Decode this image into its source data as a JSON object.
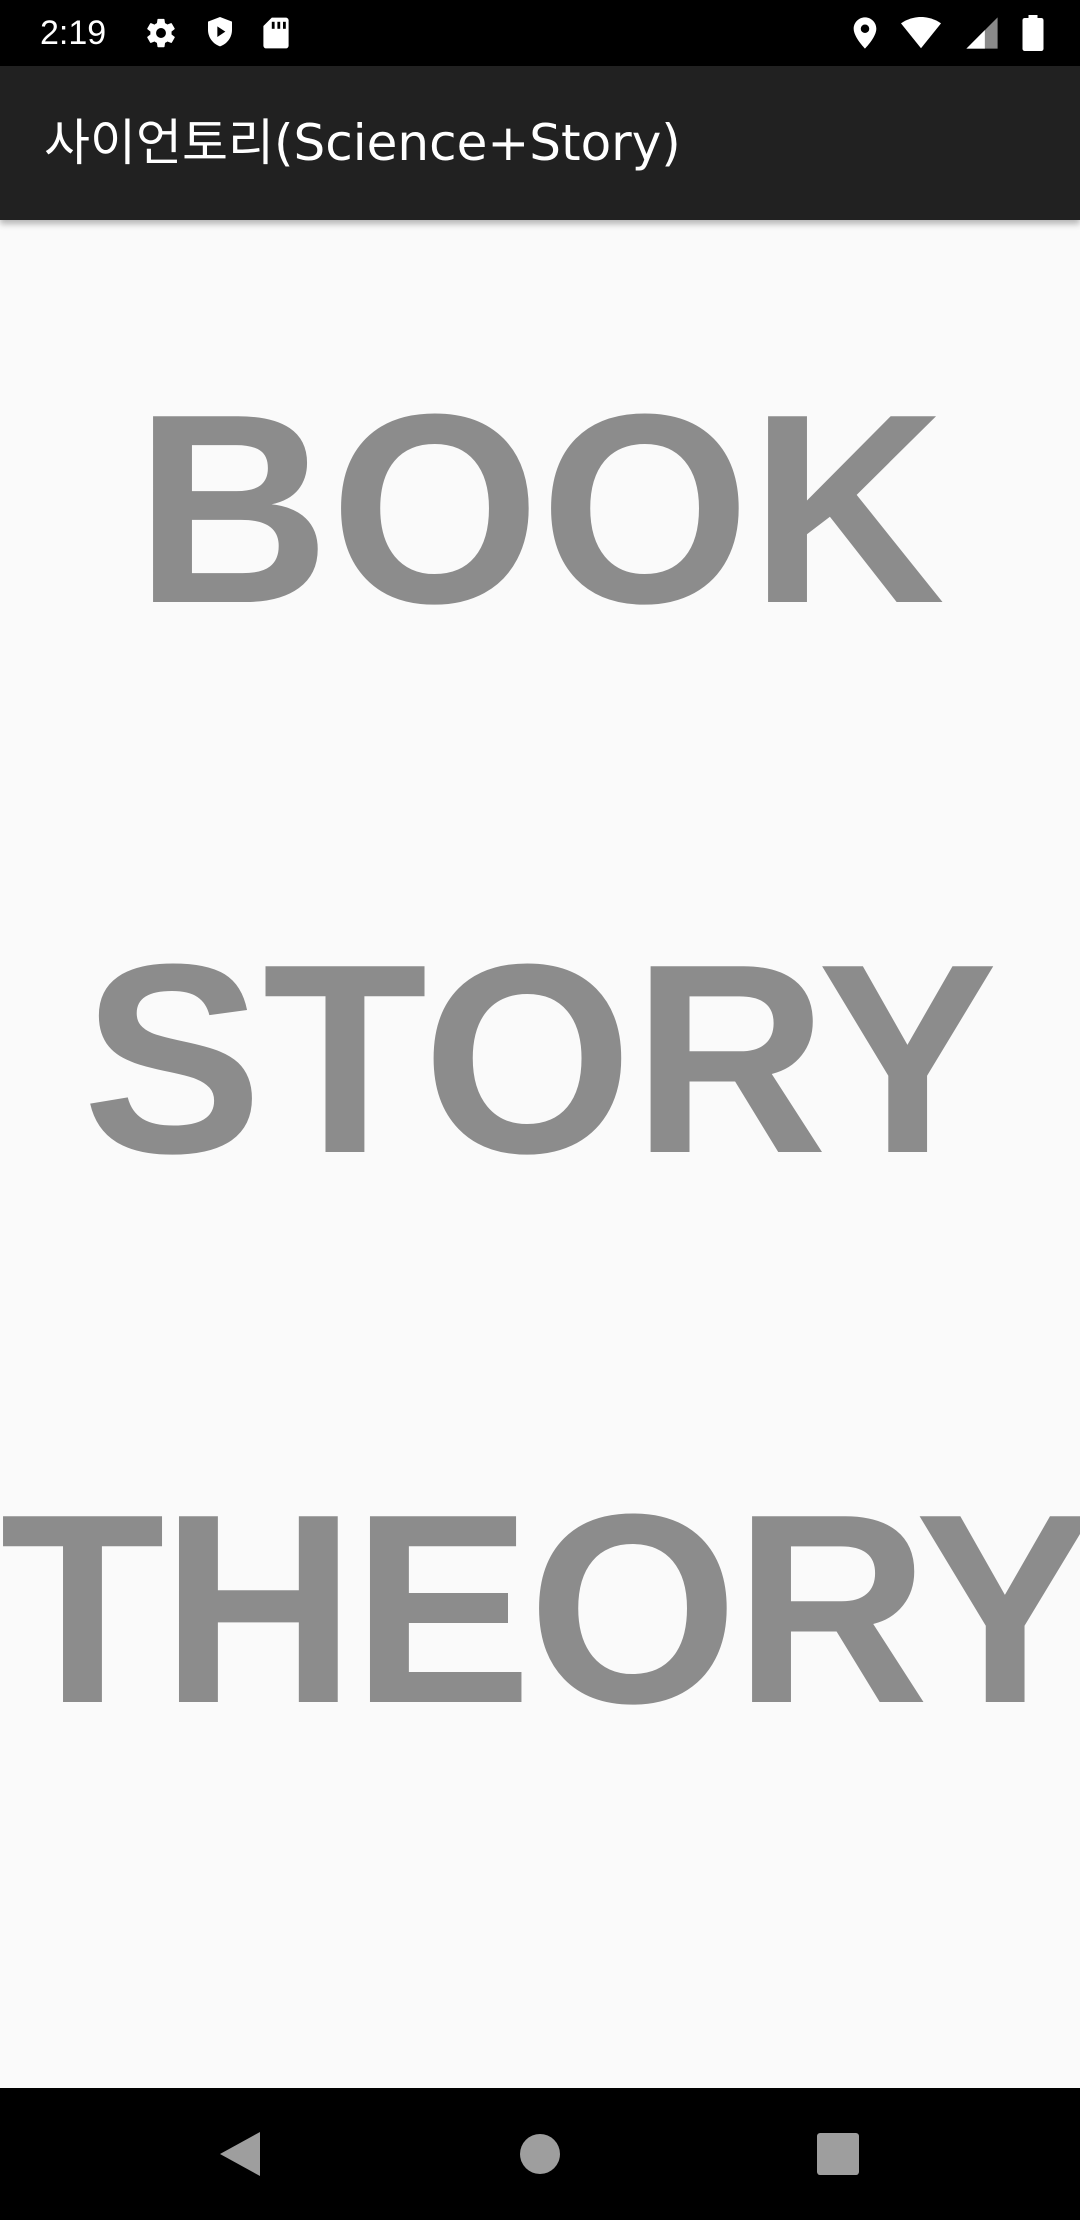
{
  "status_bar": {
    "time": "2:19",
    "left_icons": [
      "gear-icon",
      "play-protect-icon",
      "sd-card-icon"
    ],
    "right_icons": [
      "location-icon",
      "wifi-icon",
      "signal-icon",
      "battery-icon"
    ]
  },
  "app_bar": {
    "title": "사이언토리(Science+Story)"
  },
  "menu": {
    "items": [
      {
        "label": "BOOK"
      },
      {
        "label": "STORY"
      },
      {
        "label": "THEORY"
      }
    ]
  },
  "nav_bar": {
    "buttons": [
      "back-icon",
      "home-icon",
      "recents-icon"
    ]
  },
  "colors": {
    "app_bar_bg": "#212121",
    "content_bg": "#fafafa",
    "menu_text": "#8c8c8c",
    "system_bars": "#000000"
  }
}
